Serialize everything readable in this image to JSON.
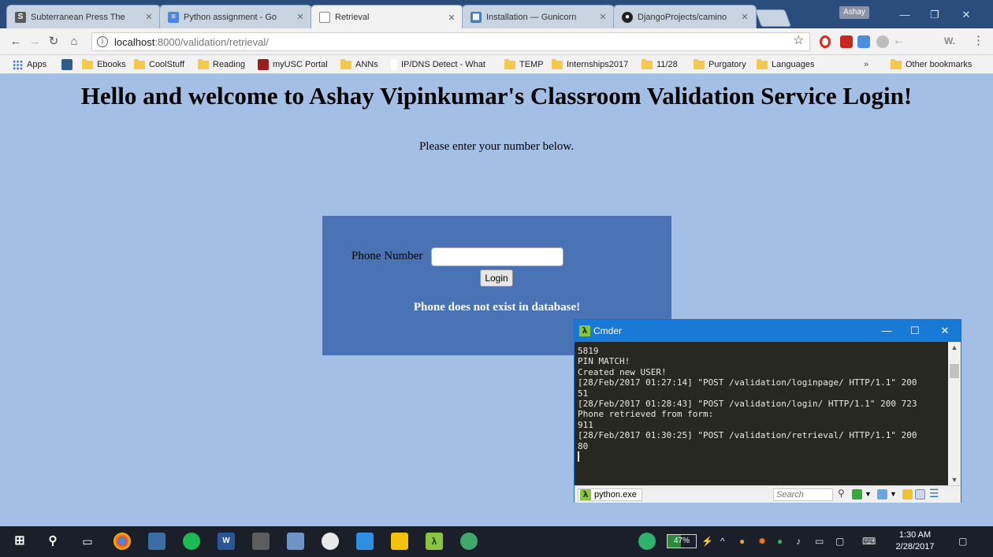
{
  "browser": {
    "tabs": [
      {
        "title": "Subterranean Press The",
        "icon_letter": "S",
        "icon_color": "#5a5a5a"
      },
      {
        "title": "Python assignment - Go",
        "icon_letter": "≡",
        "icon_color": "#4a86e8"
      },
      {
        "title": "Retrieval",
        "icon_letter": "",
        "icon_color": "#ffffff"
      },
      {
        "title": "Installation — Gunicorn",
        "icon_letter": "▦",
        "icon_color": "#4b7bb5"
      },
      {
        "title": "DjangoProjects/camino",
        "icon_letter": "●",
        "icon_color": "#222222"
      }
    ],
    "profile_name": "Ashay",
    "url_host": "localhost",
    "url_rest": ":8000/validation/retrieval/",
    "extension_text": "W.",
    "bookmarks": [
      {
        "label": "Apps",
        "type": "apps"
      },
      {
        "label": "",
        "type": "image",
        "color": "#2f5d8a"
      },
      {
        "label": "Ebooks",
        "type": "folder"
      },
      {
        "label": "CoolStuff",
        "type": "folder"
      },
      {
        "label": "Reading",
        "type": "folder"
      },
      {
        "label": "myUSC Portal",
        "type": "image",
        "color": "#9c1b1b"
      },
      {
        "label": "ANNs",
        "type": "folder"
      },
      {
        "label": "IP/DNS Detect - What",
        "type": "image",
        "color": "#ffffff"
      },
      {
        "label": "TEMP",
        "type": "folder"
      },
      {
        "label": "Internships2017",
        "type": "folder"
      },
      {
        "label": "11/28",
        "type": "folder"
      },
      {
        "label": "Purgatory",
        "type": "folder"
      },
      {
        "label": "Languages",
        "type": "folder"
      }
    ],
    "bookmarks_overflow": "»",
    "other_bookmarks": "Other bookmarks"
  },
  "page": {
    "heading": "Hello and welcome to Ashay Vipinkumar's Classroom Validation Service Login!",
    "instructions": "Please enter your number below.",
    "phone_label": "Phone Number",
    "phone_value": "",
    "login_label": "Login",
    "error": "Phone does not exist in database!",
    "background_color": "#a3bfe5",
    "panel_color": "#4a73b5"
  },
  "cmder": {
    "title": "Cmder",
    "console_lines": [
      "5819",
      "PIN MATCH!",
      "Created new USER!",
      "[28/Feb/2017 01:27:14] \"POST /validation/loginpage/ HTTP/1.1\" 200",
      "51",
      "[28/Feb/2017 01:28:43] \"POST /validation/login/ HTTP/1.1\" 200 723",
      "Phone retrieved from form:",
      "911",
      "[28/Feb/2017 01:30:25] \"POST /validation/retrieval/ HTTP/1.1\" 200",
      "80"
    ],
    "tab_label": "python.exe",
    "search_placeholder": "Search"
  },
  "taskbar": {
    "battery": "47%",
    "time": "1:30 AM",
    "date": "2/28/2017"
  }
}
